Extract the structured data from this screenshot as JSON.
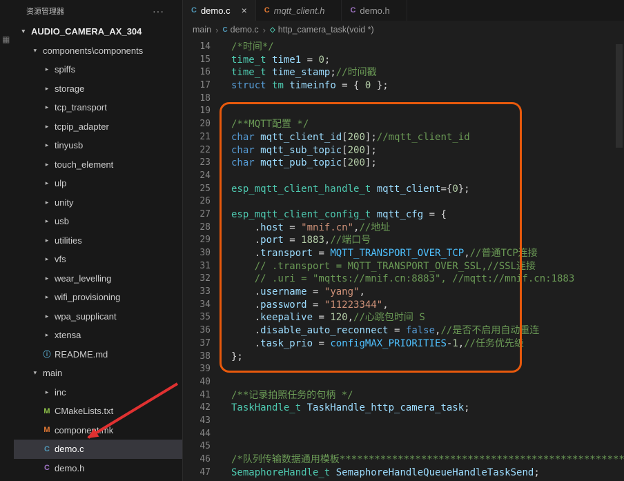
{
  "activity_bar": {
    "icon": "▦"
  },
  "explorer": {
    "title": "资源管理器",
    "more": "···",
    "tree": [
      {
        "label": "AUDIO_CAMERA_AX_304",
        "kind": "folder",
        "level": 0,
        "expanded": true,
        "bold": true
      },
      {
        "label": "components\\components",
        "kind": "folder",
        "level": 1,
        "expanded": true
      },
      {
        "label": "spiffs",
        "kind": "folder",
        "level": 2
      },
      {
        "label": "storage",
        "kind": "folder",
        "level": 2
      },
      {
        "label": "tcp_transport",
        "kind": "folder",
        "level": 2
      },
      {
        "label": "tcpip_adapter",
        "kind": "folder",
        "level": 2
      },
      {
        "label": "tinyusb",
        "kind": "folder",
        "level": 2
      },
      {
        "label": "touch_element",
        "kind": "folder",
        "level": 2
      },
      {
        "label": "ulp",
        "kind": "folder",
        "level": 2
      },
      {
        "label": "unity",
        "kind": "folder",
        "level": 2
      },
      {
        "label": "usb",
        "kind": "folder",
        "level": 2
      },
      {
        "label": "utilities",
        "kind": "folder",
        "level": 2
      },
      {
        "label": "vfs",
        "kind": "folder",
        "level": 2
      },
      {
        "label": "wear_levelling",
        "kind": "folder",
        "level": 2
      },
      {
        "label": "wifi_provisioning",
        "kind": "folder",
        "level": 2
      },
      {
        "label": "wpa_supplicant",
        "kind": "folder",
        "level": 2
      },
      {
        "label": "xtensa",
        "kind": "folder",
        "level": 2
      },
      {
        "label": "README.md",
        "kind": "file",
        "level": 2,
        "icon": "ⓘ",
        "iconColor": "#519aba"
      },
      {
        "label": "main",
        "kind": "folder",
        "level": 1,
        "expanded": true
      },
      {
        "label": "inc",
        "kind": "folder",
        "level": 2
      },
      {
        "label": "CMakeLists.txt",
        "kind": "file",
        "level": 2,
        "icon": "M",
        "iconColor": "#8dc149"
      },
      {
        "label": "component.mk",
        "kind": "file",
        "level": 2,
        "icon": "M",
        "iconColor": "#e37933"
      },
      {
        "label": "demo.c",
        "kind": "file",
        "level": 2,
        "icon": "C",
        "iconColor": "#519aba",
        "selected": true
      },
      {
        "label": "demo.h",
        "kind": "file",
        "level": 2,
        "icon": "C",
        "iconColor": "#a074c4"
      }
    ]
  },
  "tabs": [
    {
      "label": "demo.c",
      "icon": "C",
      "iconColor": "#519aba",
      "active": true,
      "close": "×"
    },
    {
      "label": "mqtt_client.h",
      "icon": "C",
      "iconColor": "#e37933",
      "italic": true
    },
    {
      "label": "demo.h",
      "icon": "C",
      "iconColor": "#a074c4"
    }
  ],
  "breadcrumb": {
    "separator": "›",
    "items": [
      {
        "label": "main"
      },
      {
        "label": "demo.c",
        "icon": "C",
        "iconColor": "#519aba"
      },
      {
        "label": "http_camera_task(void *)",
        "icon": "◇",
        "iconColor": "#4ec9b0"
      }
    ]
  },
  "editor": {
    "lines": [
      {
        "n": 14,
        "t": [
          [
            "com",
            "/*时间*/"
          ]
        ]
      },
      {
        "n": 15,
        "t": [
          [
            "type",
            "time_t"
          ],
          [
            "plain",
            " "
          ],
          [
            "var",
            "time1"
          ],
          [
            "plain",
            " = "
          ],
          [
            "num",
            "0"
          ],
          [
            "plain",
            ";"
          ]
        ]
      },
      {
        "n": 16,
        "t": [
          [
            "type",
            "time_t"
          ],
          [
            "plain",
            " "
          ],
          [
            "var",
            "time_stamp"
          ],
          [
            "plain",
            ";"
          ],
          [
            "com",
            "//时间戳"
          ]
        ]
      },
      {
        "n": 17,
        "t": [
          [
            "kw",
            "struct"
          ],
          [
            "plain",
            " "
          ],
          [
            "type",
            "tm"
          ],
          [
            "plain",
            " "
          ],
          [
            "var",
            "timeinfo"
          ],
          [
            "plain",
            " = { "
          ],
          [
            "num",
            "0"
          ],
          [
            "plain",
            " };"
          ]
        ]
      },
      {
        "n": 18,
        "t": []
      },
      {
        "n": 19,
        "t": []
      },
      {
        "n": 20,
        "t": [
          [
            "com",
            "/**MQTT配置 */"
          ]
        ]
      },
      {
        "n": 21,
        "t": [
          [
            "kw",
            "char"
          ],
          [
            "plain",
            " "
          ],
          [
            "var",
            "mqtt_client_id"
          ],
          [
            "plain",
            "["
          ],
          [
            "num",
            "200"
          ],
          [
            "plain",
            "];"
          ],
          [
            "com",
            "//mqtt_client_id"
          ]
        ]
      },
      {
        "n": 22,
        "t": [
          [
            "kw",
            "char"
          ],
          [
            "plain",
            " "
          ],
          [
            "var",
            "mqtt_sub_topic"
          ],
          [
            "plain",
            "["
          ],
          [
            "num",
            "200"
          ],
          [
            "plain",
            "];"
          ]
        ]
      },
      {
        "n": 23,
        "t": [
          [
            "kw",
            "char"
          ],
          [
            "plain",
            " "
          ],
          [
            "var",
            "mqtt_pub_topic"
          ],
          [
            "plain",
            "["
          ],
          [
            "num",
            "200"
          ],
          [
            "plain",
            "];"
          ]
        ]
      },
      {
        "n": 24,
        "t": []
      },
      {
        "n": 25,
        "t": [
          [
            "type",
            "esp_mqtt_client_handle_t"
          ],
          [
            "plain",
            " "
          ],
          [
            "var",
            "mqtt_client"
          ],
          [
            "plain",
            "={"
          ],
          [
            "num",
            "0"
          ],
          [
            "plain",
            "};"
          ]
        ]
      },
      {
        "n": 26,
        "t": []
      },
      {
        "n": 27,
        "t": [
          [
            "type",
            "esp_mqtt_client_config_t"
          ],
          [
            "plain",
            " "
          ],
          [
            "var",
            "mqtt_cfg"
          ],
          [
            "plain",
            " = {"
          ]
        ]
      },
      {
        "n": 28,
        "t": [
          [
            "plain",
            "    ."
          ],
          [
            "var",
            "host"
          ],
          [
            "plain",
            " = "
          ],
          [
            "str",
            "\"mnif.cn\""
          ],
          [
            "plain",
            ","
          ],
          [
            "com",
            "//地址"
          ]
        ]
      },
      {
        "n": 29,
        "t": [
          [
            "plain",
            "    ."
          ],
          [
            "var",
            "port"
          ],
          [
            "plain",
            " = "
          ],
          [
            "num",
            "1883"
          ],
          [
            "plain",
            ","
          ],
          [
            "com",
            "//端口号"
          ]
        ]
      },
      {
        "n": 30,
        "t": [
          [
            "plain",
            "    ."
          ],
          [
            "var",
            "transport"
          ],
          [
            "plain",
            " = "
          ],
          [
            "const",
            "MQTT_TRANSPORT_OVER_TCP"
          ],
          [
            "plain",
            ","
          ],
          [
            "com",
            "//普通TCP连接"
          ]
        ]
      },
      {
        "n": 31,
        "t": [
          [
            "com",
            "    // .transport = MQTT_TRANSPORT_OVER_SSL,//SSL连接"
          ]
        ]
      },
      {
        "n": 32,
        "t": [
          [
            "com",
            "    // .uri = \"mqtts://mnif.cn:8883\", //mqtt://mnif.cn:1883"
          ]
        ]
      },
      {
        "n": 33,
        "t": [
          [
            "plain",
            "    ."
          ],
          [
            "var",
            "username"
          ],
          [
            "plain",
            " = "
          ],
          [
            "str",
            "\"yang\""
          ],
          [
            "plain",
            ","
          ]
        ]
      },
      {
        "n": 34,
        "t": [
          [
            "plain",
            "    ."
          ],
          [
            "var",
            "password"
          ],
          [
            "plain",
            " = "
          ],
          [
            "str",
            "\"11223344\""
          ],
          [
            "plain",
            ","
          ]
        ]
      },
      {
        "n": 35,
        "t": [
          [
            "plain",
            "    ."
          ],
          [
            "var",
            "keepalive"
          ],
          [
            "plain",
            " = "
          ],
          [
            "num",
            "120"
          ],
          [
            "plain",
            ","
          ],
          [
            "com",
            "//心跳包时间 S"
          ]
        ]
      },
      {
        "n": 36,
        "t": [
          [
            "plain",
            "    ."
          ],
          [
            "var",
            "disable_auto_reconnect"
          ],
          [
            "plain",
            " = "
          ],
          [
            "kw",
            "false"
          ],
          [
            "plain",
            ","
          ],
          [
            "com",
            "//是否不启用自动重连"
          ]
        ]
      },
      {
        "n": 37,
        "t": [
          [
            "plain",
            "    ."
          ],
          [
            "var",
            "task_prio"
          ],
          [
            "plain",
            " = "
          ],
          [
            "const",
            "configMAX_PRIORITIES"
          ],
          [
            "plain",
            "-"
          ],
          [
            "num",
            "1"
          ],
          [
            "plain",
            ","
          ],
          [
            "com",
            "//任务优先级"
          ]
        ]
      },
      {
        "n": 38,
        "t": [
          [
            "plain",
            "};"
          ]
        ]
      },
      {
        "n": 39,
        "t": []
      },
      {
        "n": 40,
        "t": []
      },
      {
        "n": 41,
        "t": [
          [
            "com",
            "/**记录拍照任务的句柄 */"
          ]
        ]
      },
      {
        "n": 42,
        "t": [
          [
            "type",
            "TaskHandle_t"
          ],
          [
            "plain",
            " "
          ],
          [
            "var",
            "TaskHandle_http_camera_task"
          ],
          [
            "plain",
            ";"
          ]
        ]
      },
      {
        "n": 43,
        "t": []
      },
      {
        "n": 44,
        "t": []
      },
      {
        "n": 45,
        "t": []
      },
      {
        "n": 46,
        "t": [
          [
            "com",
            "/*队列传输数据通用模板*******************************************************"
          ]
        ]
      },
      {
        "n": 47,
        "t": [
          [
            "type",
            "SemaphoreHandle_t"
          ],
          [
            "plain",
            " "
          ],
          [
            "var",
            "SemaphoreHandleQueueHandleTaskSend"
          ],
          [
            "plain",
            ";"
          ]
        ]
      }
    ]
  },
  "annotations": {
    "box_color": "#e8590c",
    "arrow_color": "#e03131"
  }
}
